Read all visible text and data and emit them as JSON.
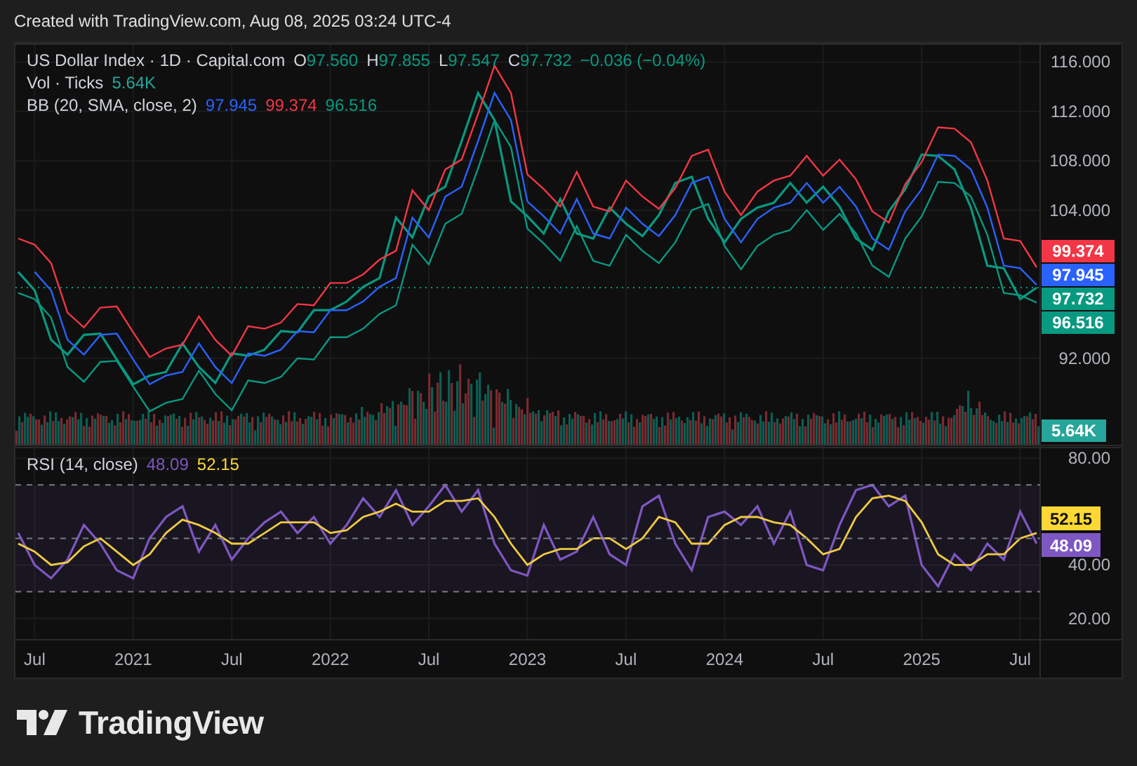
{
  "header": {
    "text": "Created with TradingView.com, Aug 08, 2025 03:24 UTC-4"
  },
  "legend": {
    "symbol": "US Dollar Index · 1D · Capital.com",
    "ohlc": [
      {
        "label": "O",
        "value": "97.560"
      },
      {
        "label": "H",
        "value": "97.855"
      },
      {
        "label": "L",
        "value": "97.547"
      },
      {
        "label": "C",
        "value": "97.732"
      }
    ],
    "change": "−0.036 (−0.04%)"
  },
  "volume_legend": {
    "label": "Vol · Ticks",
    "value": "5.64K"
  },
  "bb_legend": {
    "label": "BB (20, SMA, close, 2)",
    "values": [
      {
        "text": "97.945",
        "color": "#2962ff"
      },
      {
        "text": "99.374",
        "color": "#f23645"
      },
      {
        "text": "96.516",
        "color": "#089981"
      }
    ]
  },
  "price_badges": [
    {
      "text": "99.374",
      "color": "#f23645"
    },
    {
      "text": "97.945",
      "color": "#2962ff"
    },
    {
      "text": "97.732",
      "color": "#089981"
    },
    {
      "text": "96.516",
      "color": "#089981"
    }
  ],
  "volume_badge": {
    "text": "5.64K",
    "color": "#26a69a"
  },
  "price_chart": {
    "chart_data": {
      "type": "line",
      "x": [
        "2020-06",
        "2020-07",
        "2020-08",
        "2020-09",
        "2020-10",
        "2020-11",
        "2020-12",
        "2021-01",
        "2021-02",
        "2021-03",
        "2021-04",
        "2021-05",
        "2021-06",
        "2021-07",
        "2021-08",
        "2021-09",
        "2021-10",
        "2021-11",
        "2021-12",
        "2022-01",
        "2022-02",
        "2022-03",
        "2022-04",
        "2022-05",
        "2022-06",
        "2022-07",
        "2022-08",
        "2022-09",
        "2022-10",
        "2022-11",
        "2022-12",
        "2023-01",
        "2023-02",
        "2023-03",
        "2023-04",
        "2023-05",
        "2023-06",
        "2023-07",
        "2023-08",
        "2023-09",
        "2023-10",
        "2023-11",
        "2023-12",
        "2024-01",
        "2024-02",
        "2024-03",
        "2024-04",
        "2024-05",
        "2024-06",
        "2024-07",
        "2024-08",
        "2024-09",
        "2024-10",
        "2024-11",
        "2024-12",
        "2025-01",
        "2025-02",
        "2025-03",
        "2025-04",
        "2025-05",
        "2025-06",
        "2025-07",
        "2025-08"
      ],
      "series": [
        {
          "color": "#089981",
          "values": [
            99,
            97.5,
            93.5,
            92.3,
            93.9,
            94,
            91.9,
            89.9,
            90.6,
            90.9,
            93.2,
            91.3,
            90,
            92.4,
            92.2,
            92.7,
            94.2,
            94.1,
            95.9,
            95.9,
            96.6,
            97.8,
            98.5,
            103.4,
            101.8,
            105.1,
            105.9,
            109.6,
            113.5,
            111.3,
            104.7,
            103.5,
            102.1,
            104.9,
            102.1,
            101.7,
            104.2,
            102.9,
            101.9,
            103.6,
            106.2,
            106.7,
            103.3,
            101.4,
            103.3,
            104.2,
            104.6,
            106.2,
            104.6,
            105.9,
            104.3,
            101.7,
            100.8,
            103.9,
            105.7,
            108.5,
            108.4,
            107.3,
            104.2,
            99.5,
            99.3,
            96.8,
            97.73
          ]
        },
        {
          "color": "#f23645",
          "values": [
            101.7,
            101.2,
            99.7,
            95.7,
            94.5,
            96.1,
            96.2,
            94.1,
            92.1,
            92.8,
            93.1,
            95.4,
            93.5,
            92.2,
            94.6,
            94.4,
            94.9,
            96.4,
            96.3,
            98.1,
            98.1,
            98.8,
            100,
            100.7,
            105.6,
            104,
            107.3,
            108.1,
            111.8,
            115.7,
            113.5,
            106.9,
            105.7,
            104.3,
            107.1,
            104.3,
            103.9,
            106.4,
            105.1,
            104.1,
            105.8,
            108.4,
            108.9,
            105.5,
            103.6,
            105.5,
            106.4,
            106.8,
            108.4,
            106.8,
            108.1,
            106.5,
            103.9,
            103,
            106.1,
            107.9,
            110.7,
            110.6,
            109.5,
            106.4,
            101.7,
            101.5,
            99.374
          ]
        },
        {
          "color": "#2962ff",
          "values": [
            null,
            99,
            97.5,
            93.5,
            92.3,
            93.9,
            94,
            91.9,
            89.9,
            90.6,
            90.9,
            93.2,
            91.3,
            90,
            92.4,
            92.2,
            92.7,
            94.2,
            94.1,
            95.9,
            95.9,
            96.6,
            97.8,
            98.5,
            103.4,
            101.8,
            105.1,
            105.9,
            109.6,
            113.5,
            111.3,
            104.7,
            103.5,
            102.1,
            104.9,
            102.1,
            101.7,
            104.2,
            102.9,
            101.9,
            103.6,
            106.2,
            106.7,
            103.3,
            101.4,
            103.3,
            104.2,
            104.6,
            106.2,
            104.6,
            105.9,
            104.3,
            101.7,
            100.8,
            103.9,
            105.7,
            108.5,
            108.4,
            107.3,
            104.2,
            99.5,
            99.3,
            97.945
          ]
        },
        {
          "color": "#089981",
          "values": [
            97.3,
            96.8,
            95.3,
            91.3,
            90.1,
            91.7,
            91.8,
            89.7,
            87.7,
            88.4,
            88.7,
            91,
            89.1,
            87.8,
            90.2,
            90,
            90.5,
            92,
            91.9,
            93.7,
            93.7,
            94.4,
            95.6,
            96.3,
            101.2,
            99.6,
            102.9,
            103.7,
            107.4,
            111.3,
            109.1,
            102.5,
            101.3,
            99.9,
            102.7,
            99.9,
            99.5,
            102,
            100.7,
            99.7,
            101.4,
            104,
            104.5,
            101.1,
            99.2,
            101.1,
            102,
            102.4,
            104,
            102.4,
            103.7,
            102.1,
            99.5,
            98.6,
            101.7,
            103.5,
            106.3,
            106.2,
            105.1,
            102,
            97.3,
            97.1,
            96.516
          ]
        }
      ],
      "xlim": [
        "2020-06",
        "2026-01"
      ],
      "ylim": [
        85,
        117.5
      ],
      "yticks": [
        {
          "value": 116,
          "label": "116.000"
        },
        {
          "value": 112,
          "label": "112.000"
        },
        {
          "value": 108,
          "label": "108.000"
        },
        {
          "value": 104,
          "label": "104.000"
        },
        {
          "value": 92,
          "label": "92.000"
        }
      ]
    }
  },
  "rsi_legend": {
    "label": "RSI (14, close)",
    "values": [
      {
        "text": "48.09",
        "color": "#7e57c2"
      },
      {
        "text": "52.15",
        "color": "#fdd835"
      }
    ]
  },
  "rsi_badges": [
    {
      "text": "52.15",
      "color": "#fdd835"
    },
    {
      "text": "48.09",
      "color": "#7e57c2"
    }
  ],
  "rsi_chart": {
    "chart_data": {
      "type": "line",
      "x": [
        "2020-06",
        "2020-07",
        "2020-08",
        "2020-09",
        "2020-10",
        "2020-11",
        "2020-12",
        "2021-01",
        "2021-02",
        "2021-03",
        "2021-04",
        "2021-05",
        "2021-06",
        "2021-07",
        "2021-08",
        "2021-09",
        "2021-10",
        "2021-11",
        "2021-12",
        "2022-01",
        "2022-02",
        "2022-03",
        "2022-04",
        "2022-05",
        "2022-06",
        "2022-07",
        "2022-08",
        "2022-09",
        "2022-10",
        "2022-11",
        "2022-12",
        "2023-01",
        "2023-02",
        "2023-03",
        "2023-04",
        "2023-05",
        "2023-06",
        "2023-07",
        "2023-08",
        "2023-09",
        "2023-10",
        "2023-11",
        "2023-12",
        "2024-01",
        "2024-02",
        "2024-03",
        "2024-04",
        "2024-05",
        "2024-06",
        "2024-07",
        "2024-08",
        "2024-09",
        "2024-10",
        "2024-11",
        "2024-12",
        "2025-01",
        "2025-02",
        "2025-03",
        "2025-04",
        "2025-05",
        "2025-06",
        "2025-07",
        "2025-08"
      ],
      "series": [
        {
          "color": "#7e57c2",
          "values": [
            52,
            40,
            35,
            42,
            55,
            48,
            38,
            35,
            50,
            58,
            62,
            45,
            55,
            42,
            50,
            56,
            60,
            52,
            58,
            48,
            55,
            65,
            58,
            68,
            55,
            62,
            70,
            60,
            68,
            48,
            38,
            36,
            55,
            42,
            45,
            58,
            44,
            40,
            62,
            66,
            48,
            38,
            58,
            60,
            55,
            62,
            48,
            60,
            40,
            38,
            55,
            68,
            70,
            62,
            66,
            40,
            32,
            44,
            38,
            48,
            42,
            60,
            48
          ]
        },
        {
          "color": "#fdd835",
          "values": [
            48,
            45,
            40,
            41,
            47,
            50,
            45,
            40,
            44,
            52,
            57,
            55,
            52,
            48,
            48,
            52,
            56,
            56,
            56,
            52,
            53,
            58,
            60,
            63,
            60,
            60,
            64,
            64,
            65,
            58,
            48,
            40,
            44,
            46,
            46,
            50,
            50,
            46,
            50,
            58,
            56,
            48,
            48,
            55,
            58,
            58,
            56,
            55,
            50,
            44,
            46,
            58,
            65,
            66,
            64,
            56,
            44,
            40,
            40,
            44,
            44,
            50,
            52
          ]
        }
      ],
      "xlim": [
        "2020-06",
        "2026-01"
      ],
      "ylim": [
        12,
        84
      ],
      "xticks": [
        {
          "value": "2020-07",
          "label": "Jul"
        },
        {
          "value": "2021-01",
          "label": "2021"
        },
        {
          "value": "2021-07",
          "label": "Jul"
        },
        {
          "value": "2022-01",
          "label": "2022"
        },
        {
          "value": "2022-07",
          "label": "Jul"
        },
        {
          "value": "2023-01",
          "label": "2023"
        },
        {
          "value": "2023-07",
          "label": "Jul"
        },
        {
          "value": "2024-01",
          "label": "2024"
        },
        {
          "value": "2024-07",
          "label": "Jul"
        },
        {
          "value": "2025-01",
          "label": "2025"
        },
        {
          "value": "2025-07",
          "label": "Jul"
        }
      ],
      "yticks": [
        {
          "value": 80,
          "label": "80.00"
        },
        {
          "value": 40,
          "label": "40.00"
        },
        {
          "value": 20,
          "label": "20.00"
        }
      ]
    }
  },
  "footer": {
    "brand": "TradingView"
  }
}
